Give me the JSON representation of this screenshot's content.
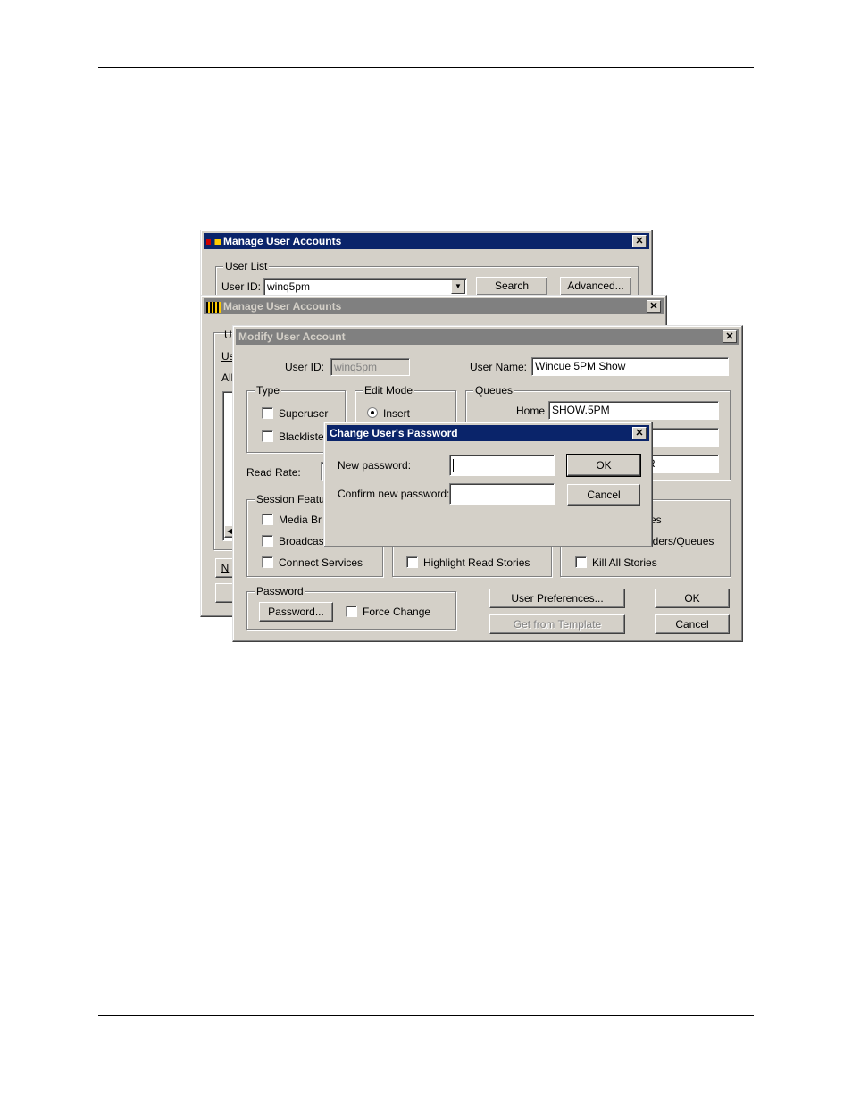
{
  "windows": {
    "manage_front": {
      "title": "Manage User Accounts",
      "user_list_group": "User List",
      "user_id_label": "User ID:",
      "user_id_value": "winq5pm",
      "search_button": "Search",
      "advanced_button": "Advanced..."
    },
    "manage_back": {
      "title": "Manage User Accounts",
      "frag_u": "U",
      "frag_us": "Us",
      "frag_all": "All",
      "frag_n": "N"
    },
    "modify": {
      "title": "Modify User Account",
      "user_id_label": "User ID:",
      "user_id_value": "winq5pm",
      "user_name_label": "User Name:",
      "user_name_value": "Wincue 5PM Show",
      "type_group": "Type",
      "superuser_label": "Superuser",
      "blacklisted_label": "Blackliste",
      "edit_mode_group": "Edit Mode",
      "insert_label": "Insert",
      "queues_group": "Queues",
      "home_label": "Home",
      "home_value": "SHOW.5PM",
      "queue3_fragment": "R",
      "read_rate_label": "Read Rate:",
      "session_group": "Session Featu",
      "media_label": "Media Br",
      "broadcast_label": "Broadcas",
      "connect_label": "Connect Services",
      "highlight_label": "Highlight Read Stories",
      "kill_label": "Kill All Stories",
      "frag_es": "es",
      "frag_folders": "lders/Queues",
      "password_group": "Password",
      "password_button": "Password...",
      "force_change_label": "Force Change",
      "user_prefs_button": "User Preferences...",
      "get_template_button": "Get from Template",
      "ok_button": "OK",
      "cancel_button": "Cancel"
    },
    "change_password": {
      "title": "Change User's Password",
      "new_password_label": "New password:",
      "confirm_label": "Confirm new password:",
      "new_password_value": "",
      "confirm_value": "",
      "ok_button": "OK",
      "cancel_button": "Cancel"
    }
  },
  "colors": {
    "active_title": "#0a246a",
    "inactive_title": "#808080",
    "face": "#d4d0c8"
  }
}
